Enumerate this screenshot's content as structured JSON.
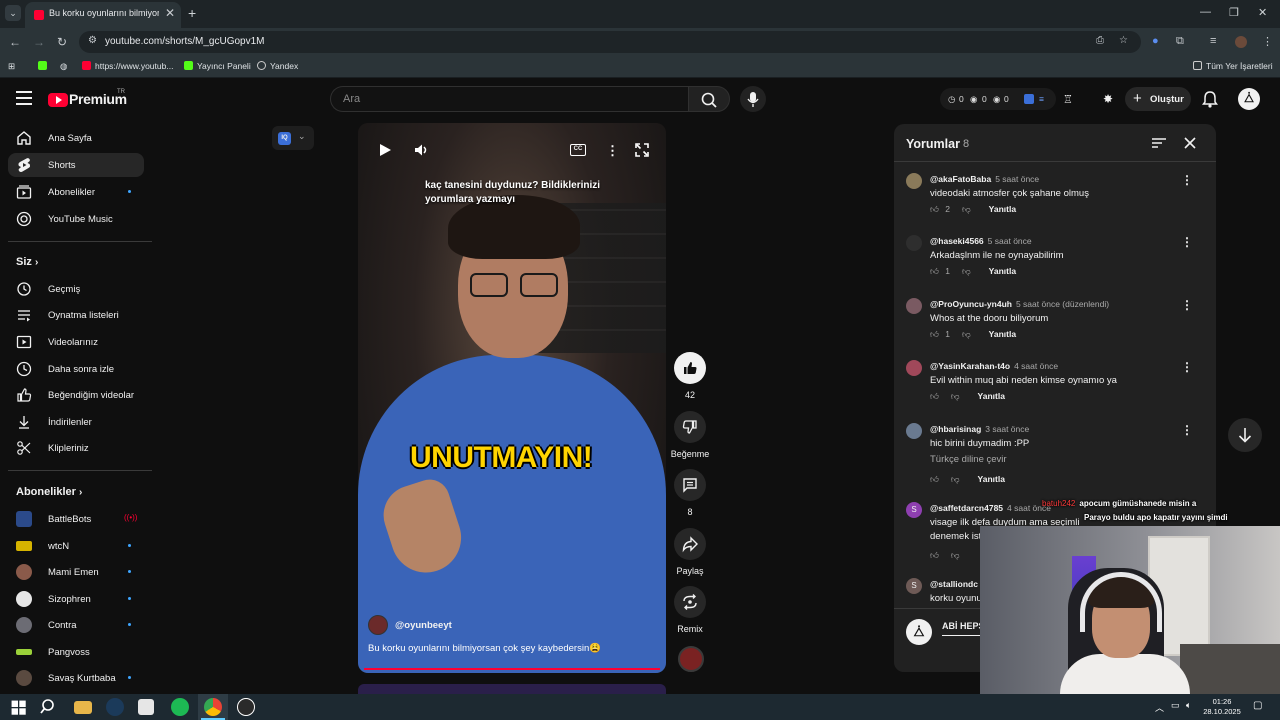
{
  "browser": {
    "tab_title": "Bu korku oyunlarını bilmiyorsan çok şey kaybedersin",
    "url": "youtube.com/shorts/M_gcUGopv1M",
    "bookmarks": [
      "https://www.youtub...",
      "Yayıncı Paneli",
      "Yandex"
    ],
    "all_bookmarks": "Tüm Yer İşaretleri"
  },
  "masthead": {
    "logo_text": "Premium",
    "logo_region": "TR",
    "search_placeholder": "Ara",
    "counters": [
      "0",
      "0",
      "0"
    ],
    "create_label": "Oluştur"
  },
  "sidebar": {
    "main": [
      {
        "label": "Ana Sayfa",
        "icon": "home-icon"
      },
      {
        "label": "Shorts",
        "icon": "shorts-icon"
      },
      {
        "label": "Abonelikler",
        "icon": "subscriptions-icon"
      },
      {
        "label": "YouTube Music",
        "icon": "music-icon"
      }
    ],
    "you_header": "Siz",
    "you": [
      {
        "label": "Geçmiş",
        "icon": "history-icon"
      },
      {
        "label": "Oynatma listeleri",
        "icon": "playlists-icon"
      },
      {
        "label": "Videolarınız",
        "icon": "your-videos-icon"
      },
      {
        "label": "Daha sonra izle",
        "icon": "watch-later-icon"
      },
      {
        "label": "Beğendiğim videolar",
        "icon": "liked-icon"
      },
      {
        "label": "İndirilenler",
        "icon": "download-icon"
      },
      {
        "label": "Klipleriniz",
        "icon": "clips-icon"
      }
    ],
    "subs_header": "Abonelikler",
    "subs": [
      {
        "label": "BattleBots",
        "badge": "live"
      },
      {
        "label": "wtcN",
        "badge": "dot"
      },
      {
        "label": "Mami Emen",
        "badge": "dot"
      },
      {
        "label": "Sizophren",
        "badge": "dot"
      },
      {
        "label": "Contra",
        "badge": "dot"
      },
      {
        "label": "Pangvoss",
        "badge": ""
      },
      {
        "label": "Savaş Kurtbaba",
        "badge": "dot"
      }
    ]
  },
  "short": {
    "caption": "kaç tanesini duydunuz? Bildiklerinizi yorumlara yazmayı",
    "overlay_title": "UNUTMAYIN!",
    "channel": "@oyunbeeyt",
    "title": "Bu korku oyunlarını bilmiyorsan çok şey kaybedersin😩",
    "cc_label": "CC"
  },
  "actions": {
    "likes": "42",
    "dislike_label": "Beğenme",
    "comments": "8",
    "share_label": "Paylaş",
    "remix_label": "Remix"
  },
  "comments_panel": {
    "title": "Yorumlar",
    "count": "8",
    "reply_label": "Yanıtla",
    "translate_label": "Türkçe diline çevir",
    "items": [
      {
        "user": "@akaFatoBaba",
        "time": "5 saat önce",
        "text": "videodaki atmosfer çok şahane olmuş",
        "likes": "2"
      },
      {
        "user": "@haseki4566",
        "time": "5 saat önce",
        "text": "Arkadaşlnm ile ne oynayabilirim",
        "likes": "1"
      },
      {
        "user": "@ProOyuncu-yn4uh",
        "time": "5 saat önce (düzenlendi)",
        "text": "Whos at the dooru biliyorum",
        "likes": "1"
      },
      {
        "user": "@YasinKarahan-t4o",
        "time": "4 saat önce",
        "text": "Evil within muq abi neden kimse oynamıo ya",
        "likes": ""
      },
      {
        "user": "@hbarisinag",
        "time": "3 saat önce",
        "text": "hic birini duymadim :PP",
        "likes": ""
      },
      {
        "user": "@saffetdarcn4785",
        "time": "4 saat önce",
        "text": "visage ilk defa duydum ama seçimli",
        "text2": "denemek ist",
        "likes": ""
      },
      {
        "user": "@stalliondc",
        "time": "",
        "text": "korku oyunu",
        "likes": ""
      }
    ],
    "input_text": "ABİ HEPS"
  },
  "stream_chat": [
    {
      "user": "batuh242",
      "text": "apocum gümüshanede misin a"
    },
    {
      "user": "",
      "text": "Parayo buldu apo kapatır yayını şimdi"
    }
  ],
  "taskbar": {
    "time": "01:26",
    "date": "28.10.2025"
  }
}
